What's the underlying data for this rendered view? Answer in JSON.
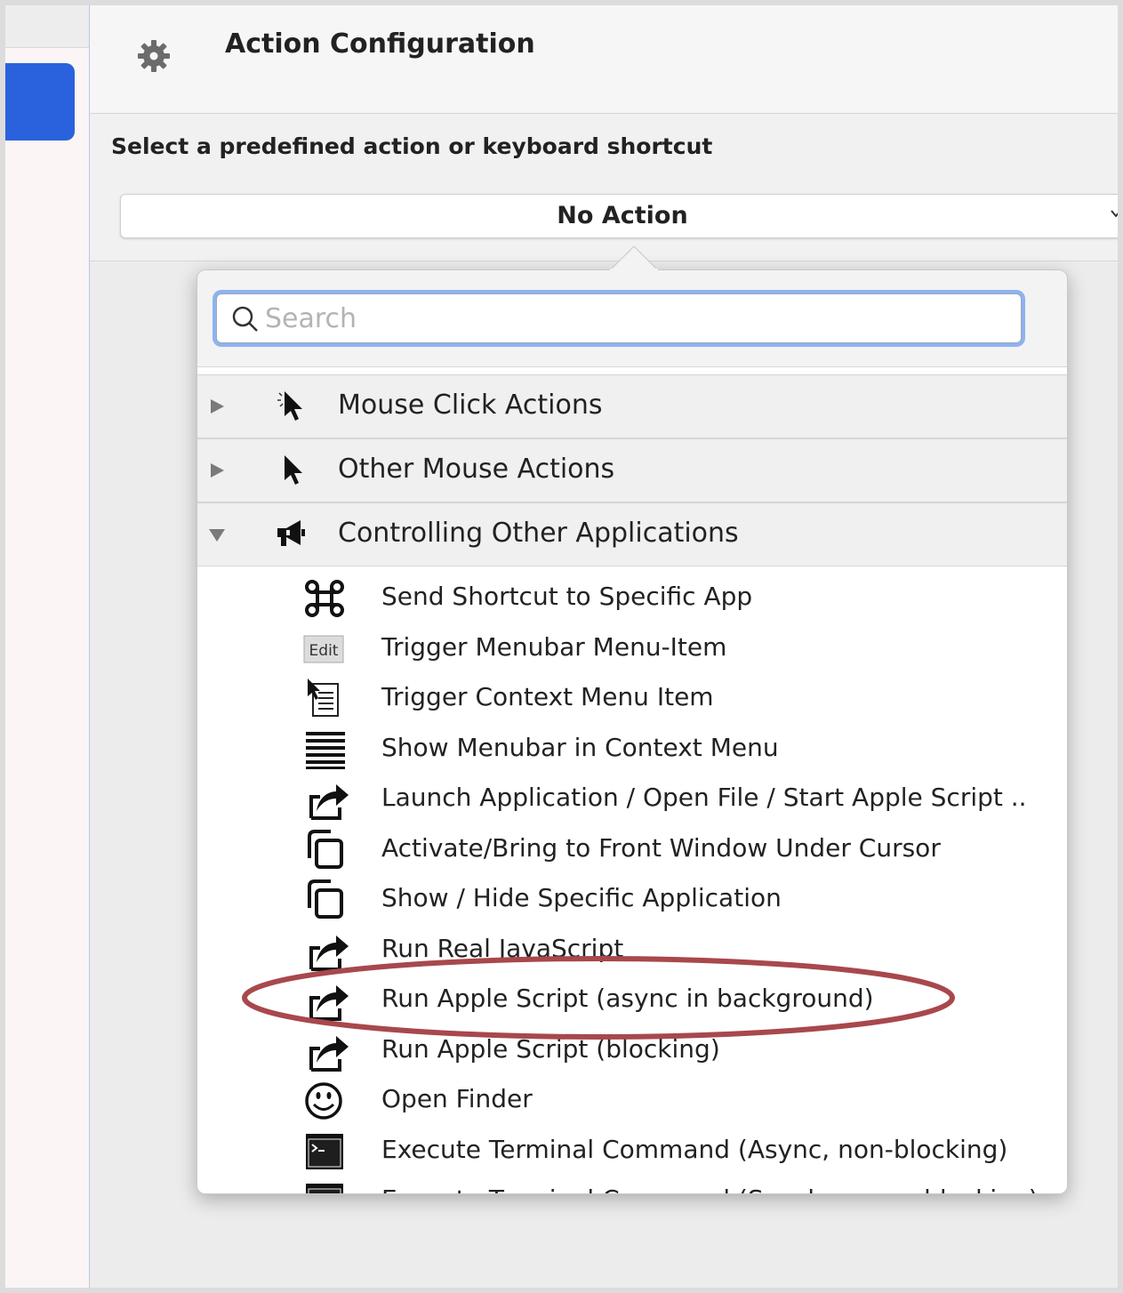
{
  "header": {
    "title": "Action Configuration",
    "icon": "gear-icon"
  },
  "config": {
    "select_label": "Select a predefined action or keyboard shortcut",
    "selected_action": "No Action"
  },
  "search": {
    "placeholder": "Search",
    "value": ""
  },
  "categories": [
    {
      "label": "Mouse Click Actions",
      "icon": "mouse-cursor-click-icon",
      "expanded": false
    },
    {
      "label": "Other Mouse Actions",
      "icon": "mouse-cursor-icon",
      "expanded": false
    },
    {
      "label": "Controlling Other Applications",
      "icon": "megaphone-icon",
      "expanded": true
    }
  ],
  "items": [
    {
      "label": "Send Shortcut to Specific App",
      "icon": "command-key-icon"
    },
    {
      "label": "Trigger Menubar Menu-Item",
      "icon": "edit-menu-icon"
    },
    {
      "label": "Trigger Context Menu Item",
      "icon": "context-menu-icon"
    },
    {
      "label": "Show Menubar in Context Menu",
      "icon": "menu-lines-icon"
    },
    {
      "label": "Launch Application / Open File / Start Apple Script ..",
      "icon": "share-arrow-icon"
    },
    {
      "label": "Activate/Bring to Front Window Under Cursor",
      "icon": "windows-icon"
    },
    {
      "label": "Show / Hide Specific Application",
      "icon": "windows-icon"
    },
    {
      "label": "Run Real JavaScript",
      "icon": "share-arrow-icon"
    },
    {
      "label": "Run Apple Script (async in background)",
      "icon": "share-arrow-icon"
    },
    {
      "label": "Run Apple Script (blocking)",
      "icon": "share-arrow-icon"
    },
    {
      "label": "Open Finder",
      "icon": "smiley-icon"
    },
    {
      "label": "Execute Terminal Command (Async, non-blocking)",
      "icon": "terminal-icon"
    },
    {
      "label": "Execute Terminal Command (Synchronous, blocking)",
      "icon": "terminal-icon"
    }
  ],
  "colors": {
    "accent": "#2a62de",
    "focus_ring": "#8db3f1",
    "annotation": "#a8484c"
  }
}
